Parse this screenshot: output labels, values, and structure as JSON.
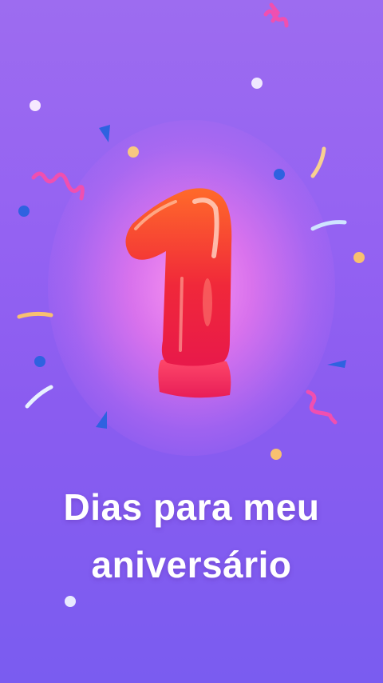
{
  "number_graphic": "1",
  "title": {
    "line1": "Dias para meu",
    "line2": "aniversário"
  },
  "colors": {
    "background_top": "#9d6cf0",
    "background_bottom": "#7a5cf0",
    "glow": "#ff96f0",
    "balloon_top": "#ff6a2a",
    "balloon_bottom": "#e8194a",
    "confetti_blue": "#2f62e0",
    "confetti_pink": "#f04fb0",
    "confetti_gold": "#f8c070",
    "text": "#ffffff"
  },
  "icons": [
    "balloon-number-one-icon",
    "confetti-icon"
  ]
}
